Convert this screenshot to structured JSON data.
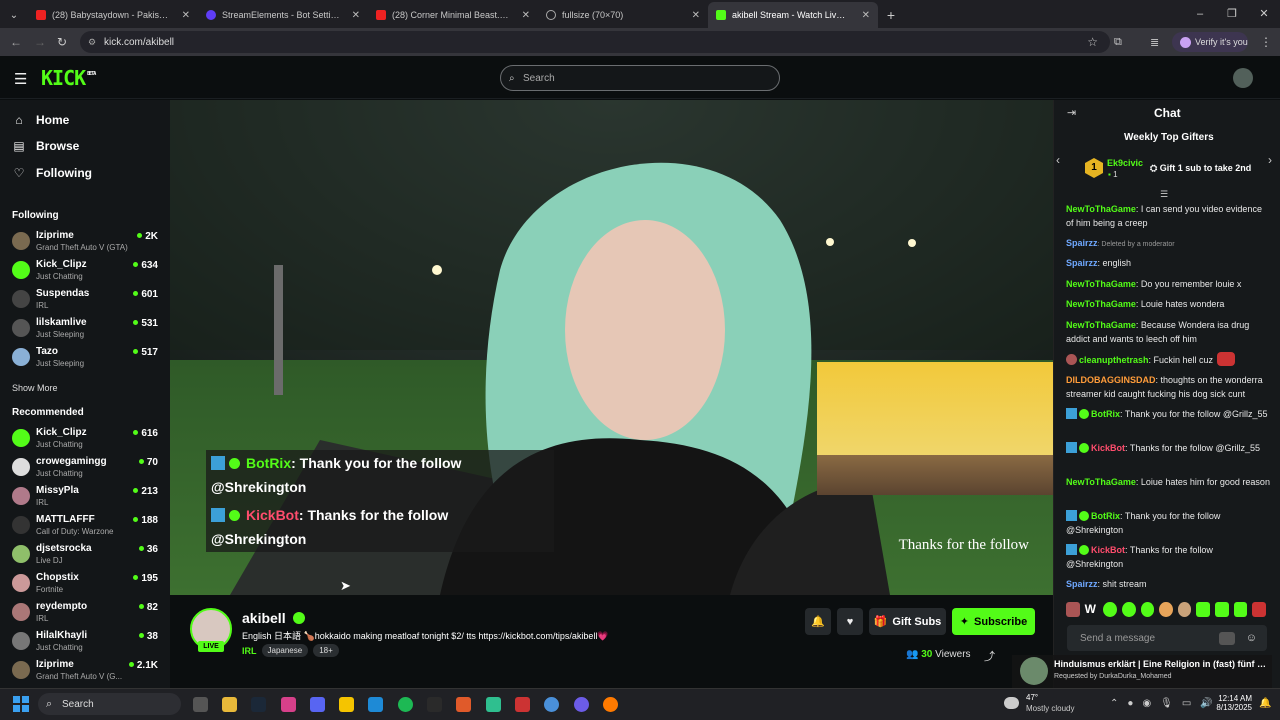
{
  "browser": {
    "tabs": [
      {
        "title": "(28) Babystaydown - Pakistan (",
        "color": "#e22"
      },
      {
        "title": "StreamElements - Bot Settings",
        "color": "#5f3df6"
      },
      {
        "title": "(28) Corner Minimal Beast. (Vol",
        "color": "#e22"
      },
      {
        "title": "fullsize (70×70)",
        "color": "#888"
      },
      {
        "title": "akibell Stream - Watch Live on",
        "color": "#53fc18"
      }
    ],
    "url": "kick.com/akibell",
    "profile_label": "Verify it's you"
  },
  "site": {
    "logo": "KICK",
    "logo_badge": "BETA",
    "search_placeholder": "Search",
    "accent": "#53fc18"
  },
  "sidebar": {
    "nav": [
      {
        "label": "Home",
        "icon": "home-icon"
      },
      {
        "label": "Browse",
        "icon": "browse-icon"
      },
      {
        "label": "Following",
        "icon": "heart-icon"
      }
    ],
    "following_header": "Following",
    "following": [
      {
        "name": "Iziprime",
        "category": "Grand Theft Auto V (GTA)",
        "viewers": "2K"
      },
      {
        "name": "Kick_Clipz",
        "category": "Just Chatting",
        "viewers": "634"
      },
      {
        "name": "Suspendas",
        "category": "IRL",
        "viewers": "601"
      },
      {
        "name": "lilskamlive",
        "category": "Just Sleeping",
        "viewers": "531"
      },
      {
        "name": "Tazo",
        "category": "Just Sleeping",
        "viewers": "517"
      }
    ],
    "show_more": "Show More",
    "recommended_header": "Recommended",
    "recommended": [
      {
        "name": "Kick_Clipz",
        "category": "Just Chatting",
        "viewers": "616"
      },
      {
        "name": "crowegamingg",
        "category": "Just Chatting",
        "viewers": "70"
      },
      {
        "name": "MissyPla",
        "category": "IRL",
        "viewers": "213"
      },
      {
        "name": "MATTLAFFF",
        "category": "Call of Duty: Warzone",
        "viewers": "188"
      },
      {
        "name": "djsetsrocka",
        "category": "Live DJ",
        "viewers": "36"
      },
      {
        "name": "Chopstix",
        "category": "Fortnite",
        "viewers": "195"
      },
      {
        "name": "reydempto",
        "category": "IRL",
        "viewers": "82"
      },
      {
        "name": "HilalKhayli",
        "category": "Just Chatting",
        "viewers": "38"
      },
      {
        "name": "Iziprime",
        "category": "Grand Theft Auto V (G...",
        "viewers": "2.1K"
      }
    ]
  },
  "video": {
    "alert1_user": "BotRix",
    "alert1_text": ": Thank you for the follow",
    "alert1_target": "@Shrekington",
    "alert2_user": "KickBot",
    "alert2_text": ": Thanks for the follow",
    "alert2_target": "@Shrekington",
    "overlay_text": "Thanks for the follow"
  },
  "stream": {
    "streamer": "akibell",
    "live": "LIVE",
    "title": "English  日本語  🍗hokkaido making meatloaf tonight  $2/ tts https://kickbot.com/tips/akibell💗",
    "category": "IRL",
    "tags": [
      "Japanese",
      "18+"
    ],
    "gift_label": "Gift Subs",
    "subscribe_label": "Subscribe",
    "viewers": "30",
    "viewers_label": "Viewers"
  },
  "chat": {
    "header": "Chat",
    "top_gifters_title": "Weekly Top Gifters",
    "top_gifter_rank": "1",
    "top_gifter": "Ek9civic",
    "top_gifter_count": "1",
    "gift_prompt": "Gift 1 sub to take 2nd",
    "messages": [
      {
        "user": "NewToThaGame",
        "color": "#53fc18",
        "text": ": I can send you video evidence of him being a creep"
      },
      {
        "user": "Spairzz",
        "color": "#6fa8ff",
        "text": ": Deleted by a moderator"
      },
      {
        "user": "Spairzz",
        "color": "#6fa8ff",
        "text": ": english"
      },
      {
        "user": "NewToThaGame",
        "color": "#53fc18",
        "text": ": Do you remember louie x"
      },
      {
        "user": "NewToThaGame",
        "color": "#53fc18",
        "text": ": Louie hates wondera"
      },
      {
        "user": "NewToThaGame",
        "color": "#53fc18",
        "text": ": Because Wondera isa drug addict and wants to leech off him"
      },
      {
        "user": "cleanupthetrash",
        "color": "#53fc18",
        "text": ": Fuckin hell cuz"
      },
      {
        "user": "DILDOBAGGINSDAD",
        "color": "#ff9c3a",
        "text": ": thoughts on the wonderra streamer kid caught fucking his dog sick cunt"
      },
      {
        "user": "BotRix",
        "color": "#53fc18",
        "text": ": Thank you for the follow @Grillz_55"
      },
      {
        "user": "KickBot",
        "color": "#ff4d6d",
        "text": ": Thanks for the follow @Grillz_55"
      },
      {
        "user": "NewToThaGame",
        "color": "#53fc18",
        "text": ": Loiue hates him for good reason"
      },
      {
        "user": "BotRix",
        "color": "#53fc18",
        "text": ": Thank you for the follow @Shrekington"
      },
      {
        "user": "KickBot",
        "color": "#ff4d6d",
        "text": ": Thanks for the follow @Shrekington"
      },
      {
        "user": "Spairzz",
        "color": "#6fa8ff",
        "text": ": shit stream"
      }
    ],
    "input_placeholder": "Send a message",
    "notif_title": "Hinduismus erklärt | Eine Religion in (fast) fünf M...",
    "notif_sub": "Requested by DurkaDurka_Mohamed"
  },
  "taskbar": {
    "search_placeholder": "Search",
    "weather": "Mostly cloudy",
    "temp": "47°",
    "time": "12:14 AM",
    "date": "8/13/2025"
  }
}
